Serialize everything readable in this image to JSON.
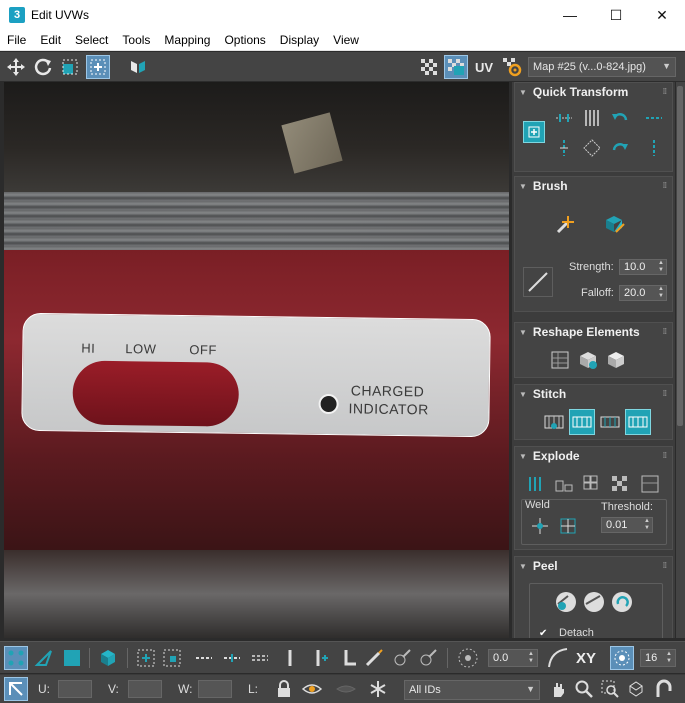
{
  "window": {
    "app_icon_text": "3",
    "title": "Edit UVWs",
    "minimize": "—",
    "maximize": "☐",
    "close": "✕"
  },
  "menu": [
    "File",
    "Edit",
    "Select",
    "Tools",
    "Mapping",
    "Options",
    "Display",
    "View"
  ],
  "toolbar": {
    "uv_label": "UV",
    "map_select": "Map #25 (v...0-824.jpg)"
  },
  "viewport": {
    "texture_labels": {
      "hi": "HI",
      "low": "LOW",
      "off": "OFF",
      "charged": "CHARGED",
      "indicator": "INDICATOR"
    }
  },
  "panel": {
    "quick_transform": {
      "title": "Quick Transform"
    },
    "brush": {
      "title": "Brush",
      "strength_label": "Strength:",
      "strength_value": "10.0",
      "falloff_label": "Falloff:",
      "falloff_value": "20.0"
    },
    "reshape": {
      "title": "Reshape Elements"
    },
    "stitch": {
      "title": "Stitch"
    },
    "explode": {
      "title": "Explode",
      "weld_label": "Weld",
      "threshold_label": "Threshold:",
      "threshold_value": "0.01"
    },
    "peel": {
      "title": "Peel",
      "detach_label": "Detach",
      "detach_checked": true
    }
  },
  "bottom": {
    "angle_value": "0.0",
    "xy_label": "XY",
    "count_value": "16",
    "u_label": "U:",
    "v_label": "V:",
    "w_label": "W:",
    "l_label": "L:",
    "ids_select": "All IDs"
  },
  "colors": {
    "accent_teal": "#21a3b5",
    "active_blue": "#5b8fb8",
    "panel_bg": "#444444"
  }
}
